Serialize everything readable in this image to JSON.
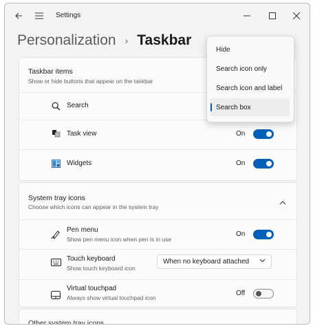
{
  "window": {
    "app_title": "Settings"
  },
  "icons": {
    "back": "back-arrow-icon",
    "menu": "hamburger-menu-icon",
    "minimize": "minimize-icon",
    "maximize": "maximize-icon",
    "close": "close-icon"
  },
  "breadcrumb": {
    "parent": "Personalization",
    "separator": "›",
    "current": "Taskbar"
  },
  "taskbar_items": {
    "title": "Taskbar items",
    "description": "Show or hide buttons that appear on the taskbar",
    "rows": [
      {
        "label": "Search",
        "icon": "search-icon"
      },
      {
        "label": "Task view",
        "icon": "task-view-icon",
        "state": "On",
        "on": true
      },
      {
        "label": "Widgets",
        "icon": "widgets-icon",
        "state": "On",
        "on": true
      }
    ]
  },
  "search_menu": {
    "options": [
      "Hide",
      "Search icon only",
      "Search icon and label",
      "Search box"
    ],
    "selected": "Search box"
  },
  "system_tray": {
    "title": "System tray icons",
    "description": "Choose which icons can appear in the system tray",
    "rows": [
      {
        "label": "Pen menu",
        "description": "Show pen menu icon when pen is in use",
        "state": "On",
        "on": true,
        "icon": "pen-icon"
      },
      {
        "label": "Touch keyboard",
        "description": "Show touch keyboard icon",
        "select_value": "When no keyboard attached",
        "icon": "keyboard-icon"
      },
      {
        "label": "Virtual touchpad",
        "description": "Always show virtual touchpad icon",
        "state": "Off",
        "on": false,
        "icon": "touchpad-icon"
      }
    ]
  },
  "other_tray": {
    "title": "Other system tray icons"
  }
}
